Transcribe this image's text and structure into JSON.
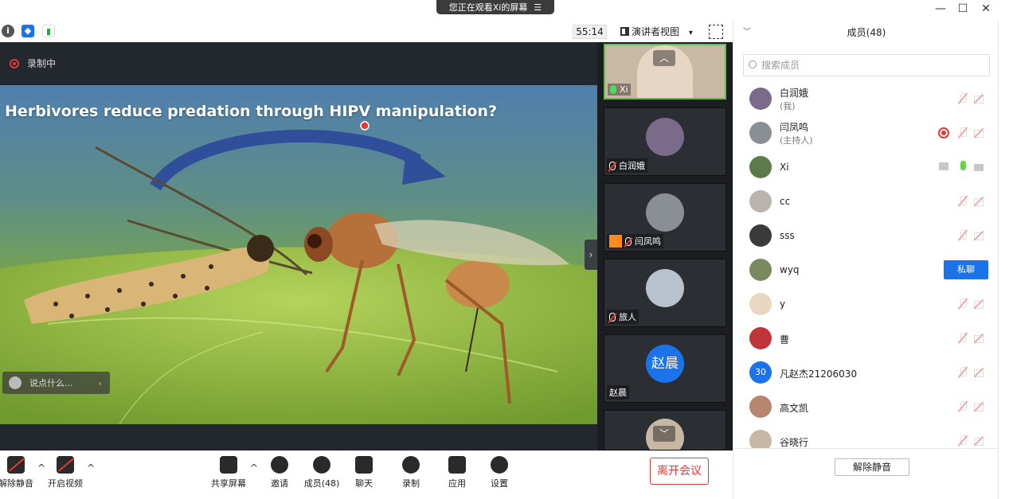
{
  "titlebar": {
    "share_banner": "您正在观看Xi的屏幕",
    "banner_icon": "list-icon",
    "minimize": "—",
    "maximize": "☐",
    "close": "✕"
  },
  "status": {
    "timer": "55:14",
    "view_mode": "演讲者视图",
    "view_caret": "▾"
  },
  "stage": {
    "recording_label": "录制中",
    "slide_title": "Herbivores reduce predation through HIPV manipulation?",
    "chat_placeholder": "说点什么...",
    "chat_chevron": "‹",
    "expand_chevron": "›"
  },
  "gallery": {
    "tiles": [
      {
        "name": "Xi",
        "mic": "on"
      },
      {
        "name": "白润娥",
        "mic": "off"
      },
      {
        "name": "闫凤鸣",
        "mic": "off"
      },
      {
        "name": "旅人",
        "mic": "off"
      },
      {
        "name": "赵晨",
        "avatar_text": "赵晨"
      }
    ],
    "scroll_up": "︿",
    "scroll_down": "﹀"
  },
  "toolbar": {
    "unmute": "解除静音",
    "video": "开启视频",
    "share": "共享屏幕",
    "invite": "邀请",
    "members": "成员(48)",
    "chat": "聊天",
    "record": "录制",
    "apps": "应用",
    "settings": "设置",
    "leave": "离开会议",
    "caret": "^"
  },
  "panel": {
    "title": "成员(48)",
    "collapse": "﹀",
    "search_placeholder": "搜索成员",
    "members": [
      {
        "name": "白润娥",
        "sub": "(我)",
        "color": "#7a6b8a"
      },
      {
        "name": "闫凤鸣",
        "sub": "(主持人)",
        "color": "#8a8f96"
      },
      {
        "name": "Xi",
        "sub": "",
        "color": "#5d7a4a"
      },
      {
        "name": "cc",
        "sub": "",
        "color": "#b9b4ae"
      },
      {
        "name": "sss",
        "sub": "",
        "color": "#3a3a3a"
      },
      {
        "name": "wyq",
        "sub": "",
        "color": "#7b8a5e"
      },
      {
        "name": "y",
        "sub": "",
        "color": "#e9d7c2"
      },
      {
        "name": "曹",
        "sub": "",
        "color": "#c0343a"
      },
      {
        "name": "凡赵杰21206030",
        "sub": "",
        "color": "#1a73e8",
        "avatar_text": "30"
      },
      {
        "name": "高文凯",
        "sub": "",
        "color": "#b8866f"
      },
      {
        "name": "谷晓行",
        "sub": "",
        "color": "#c7b8a5"
      }
    ],
    "private_chat": "私聊",
    "unmute_all": "解除静音"
  }
}
